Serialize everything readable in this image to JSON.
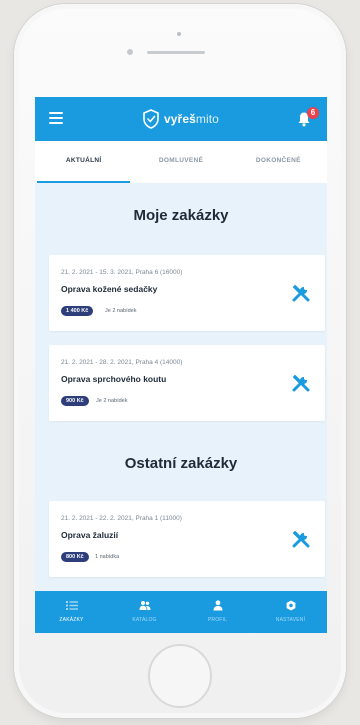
{
  "app": {
    "logo_bold": "vyřeš",
    "logo_light": "mito",
    "notification_count": "6"
  },
  "tabs": [
    {
      "label": "AKTUÁLNÍ",
      "active": true
    },
    {
      "label": "DOMLUVENÉ",
      "active": false
    },
    {
      "label": "DOKONČENÉ",
      "active": false
    }
  ],
  "sections": {
    "mine_title": "Moje zakázky",
    "other_title": "Ostatní zakázky"
  },
  "my_orders": [
    {
      "date_location": "21. 2. 2021 - 15. 3. 2021, Praha 6 (16000)",
      "title": "Oprava kožené sedačky",
      "price": "1 400 Kč",
      "offers": "Je 2 nabídek",
      "icon": "tools-icon"
    },
    {
      "date_location": "21. 2. 2021 - 28. 2. 2021, Praha 4 (14000)",
      "title": "Oprava sprchového koutu",
      "price": "900 Kč",
      "offers": "Je 2 nabídek",
      "icon": "tools-icon"
    }
  ],
  "other_orders": [
    {
      "date_location": "21. 2. 2021 - 22. 2. 2021, Praha 1 (11000)",
      "title": "Oprava žaluzií",
      "price": "800 Kč",
      "offers": "1 nabídka",
      "icon": "tools-icon"
    }
  ],
  "bottom_nav": [
    {
      "label": "ZAKÁZKY",
      "icon": "list-icon",
      "active": true
    },
    {
      "label": "KATALOG",
      "icon": "users-icon",
      "active": false
    },
    {
      "label": "PROFIL",
      "icon": "user-icon",
      "active": false
    },
    {
      "label": "NASTAVENÍ",
      "icon": "gear-icon",
      "active": false
    }
  ],
  "colors": {
    "primary": "#1a9be0",
    "badge": "#e8434d",
    "price_pill": "#2e3e7a",
    "background": "#e8f2fa"
  }
}
